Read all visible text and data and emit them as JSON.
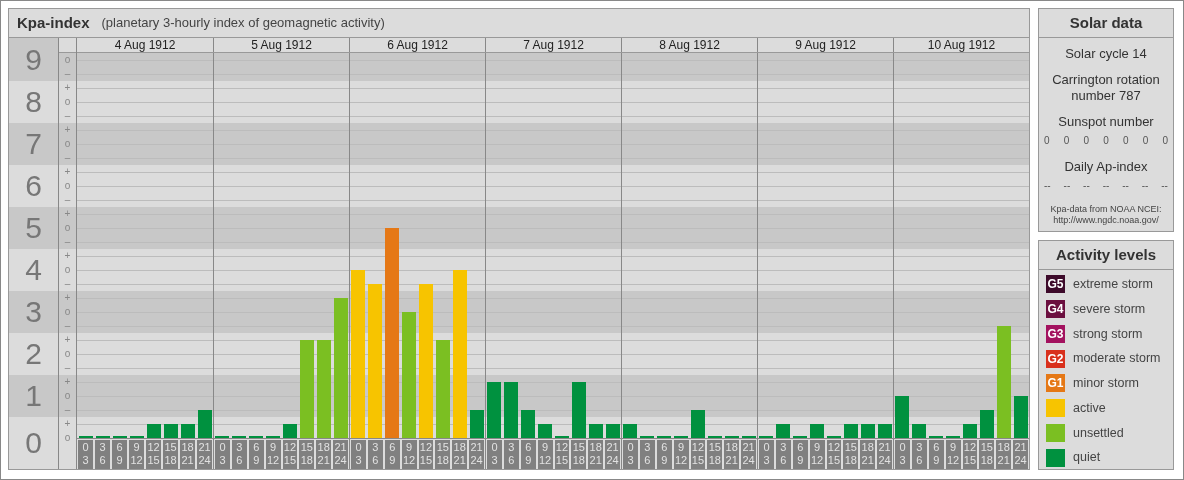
{
  "header": {
    "title": "Kpa-index",
    "subtitle": "(planetary 3-hourly index of geomagnetic activity)"
  },
  "plot": {
    "days": [
      "4 Aug 1912",
      "5 Aug 1912",
      "6 Aug 1912",
      "7 Aug 1912",
      "8 Aug 1912",
      "9 Aug 1912",
      "10 Aug 1912"
    ],
    "marks": [
      "o",
      "–",
      "+",
      "o",
      "–",
      "+",
      "o",
      "–",
      "+",
      "o",
      "–",
      "+",
      "o",
      "–",
      "+",
      "o",
      "–",
      "+",
      "o",
      "–",
      "+",
      "o",
      "–",
      "+",
      "o",
      "–",
      "+",
      "o"
    ],
    "chart_data": {
      "type": "bar",
      "stacked": true,
      "grid": true,
      "ylim": [
        0,
        9
      ],
      "yticks": [
        {
          "value": 9,
          "label": "9"
        },
        {
          "value": 8,
          "label": "8"
        },
        {
          "value": 7,
          "label": "7"
        },
        {
          "value": 6,
          "label": "6"
        },
        {
          "value": 5,
          "label": "5"
        },
        {
          "value": 4,
          "label": "4"
        },
        {
          "value": 3,
          "label": "3"
        },
        {
          "value": 2,
          "label": "2"
        },
        {
          "value": 1,
          "label": "1"
        },
        {
          "value": 0,
          "label": "0"
        }
      ],
      "categories": [
        "0 3",
        "3 6",
        "6 9",
        "9 12",
        "12 15",
        "15 18",
        "18 21",
        "21 24",
        "0 3",
        "3 6",
        "6 9",
        "9 12",
        "12 15",
        "15 18",
        "18 21",
        "21 24",
        "0 3",
        "3 6",
        "6 9",
        "9 12",
        "12 15",
        "15 18",
        "18 21",
        "21 24",
        "0 3",
        "3 6",
        "6 9",
        "9 12",
        "12 15",
        "15 18",
        "18 21",
        "21 24",
        "0 3",
        "3 6",
        "6 9",
        "9 12",
        "12 15",
        "15 18",
        "18 21",
        "21 24",
        "0 3",
        "3 6",
        "6 9",
        "9 12",
        "12 15",
        "15 18",
        "18 21",
        "21 24",
        "0 3",
        "3 6",
        "6 9",
        "9 12",
        "12 15",
        "15 18",
        "18 21",
        "21 24"
      ],
      "series": [
        {
          "color": "#00913f",
          "values": [
            0,
            0,
            0,
            0,
            0.33,
            0.33,
            0.33,
            0.67,
            0,
            0,
            0,
            0,
            0.33,
            null,
            null,
            null,
            null,
            null,
            null,
            null,
            null,
            null,
            null,
            0.67,
            1.33,
            1.33,
            0.67,
            0.33,
            0,
            1.33,
            0.33,
            0.33,
            0.33,
            0,
            0,
            0,
            0.67,
            0,
            0,
            0,
            0,
            0.33,
            0,
            0.33,
            0,
            0.33,
            0.33,
            0.33,
            1,
            0.33,
            0,
            0,
            0.33,
            0.67,
            null,
            1
          ]
        },
        {
          "color": "#7bbf22",
          "values": [
            null,
            null,
            null,
            null,
            null,
            null,
            null,
            null,
            null,
            null,
            null,
            null,
            null,
            2.33,
            2.33,
            3.33,
            null,
            null,
            null,
            3,
            null,
            2.33,
            null,
            null,
            null,
            null,
            null,
            null,
            null,
            null,
            null,
            null,
            null,
            null,
            null,
            null,
            null,
            null,
            null,
            null,
            null,
            null,
            null,
            null,
            null,
            null,
            null,
            null,
            null,
            null,
            null,
            null,
            null,
            null,
            2.67,
            null
          ]
        },
        {
          "color": "#f7c400",
          "values": [
            null,
            null,
            null,
            null,
            null,
            null,
            null,
            null,
            null,
            null,
            null,
            null,
            null,
            null,
            null,
            null,
            4,
            3.67,
            null,
            null,
            3.67,
            null,
            4,
            null,
            null,
            null,
            null,
            null,
            null,
            null,
            null,
            null,
            null,
            null,
            null,
            null,
            null,
            null,
            null,
            null,
            null,
            null,
            null,
            null,
            null,
            null,
            null,
            null,
            null,
            null,
            null,
            null,
            null,
            null,
            null,
            null
          ]
        },
        {
          "color": "#e57816",
          "values": [
            null,
            null,
            null,
            null,
            null,
            null,
            null,
            null,
            null,
            null,
            null,
            null,
            null,
            null,
            null,
            null,
            null,
            null,
            5,
            null,
            null,
            null,
            null,
            null,
            null,
            null,
            null,
            null,
            null,
            null,
            null,
            null,
            null,
            null,
            null,
            null,
            null,
            null,
            null,
            null,
            null,
            null,
            null,
            null,
            null,
            null,
            null,
            null,
            null,
            null,
            null,
            null,
            null,
            null,
            null,
            null
          ]
        }
      ]
    }
  },
  "solar_data": {
    "title": "Solar data",
    "solar_cycle": "Solar cycle 14",
    "carrington": "Carrington rotation number 787",
    "sunspot_label": "Sunspot number",
    "sunspots": [
      "0",
      "0",
      "0",
      "0",
      "0",
      "0",
      "0"
    ],
    "ap_label": "Daily Ap-index",
    "ap_values": [
      "--",
      "--",
      "--",
      "--",
      "--",
      "--",
      "--"
    ],
    "source": "Kpa-data from NOAA NCEI:",
    "source_url": "http://www.ngdc.noaa.gov/"
  },
  "legend": {
    "title": "Activity levels",
    "items": [
      {
        "badge": "G5",
        "label": "extreme storm",
        "color": "#3d0a2a"
      },
      {
        "badge": "G4",
        "label": "severe storm",
        "color": "#6b0f3f"
      },
      {
        "badge": "G3",
        "label": "strong storm",
        "color": "#a3125f"
      },
      {
        "badge": "G2",
        "label": "moderate storm",
        "color": "#d9301c"
      },
      {
        "badge": "G1",
        "label": "minor storm",
        "color": "#e57816"
      },
      {
        "label": "active",
        "color": "#f7c400"
      },
      {
        "label": "unsettled",
        "color": "#7bbf22"
      },
      {
        "label": "quiet",
        "color": "#00913f"
      }
    ]
  }
}
